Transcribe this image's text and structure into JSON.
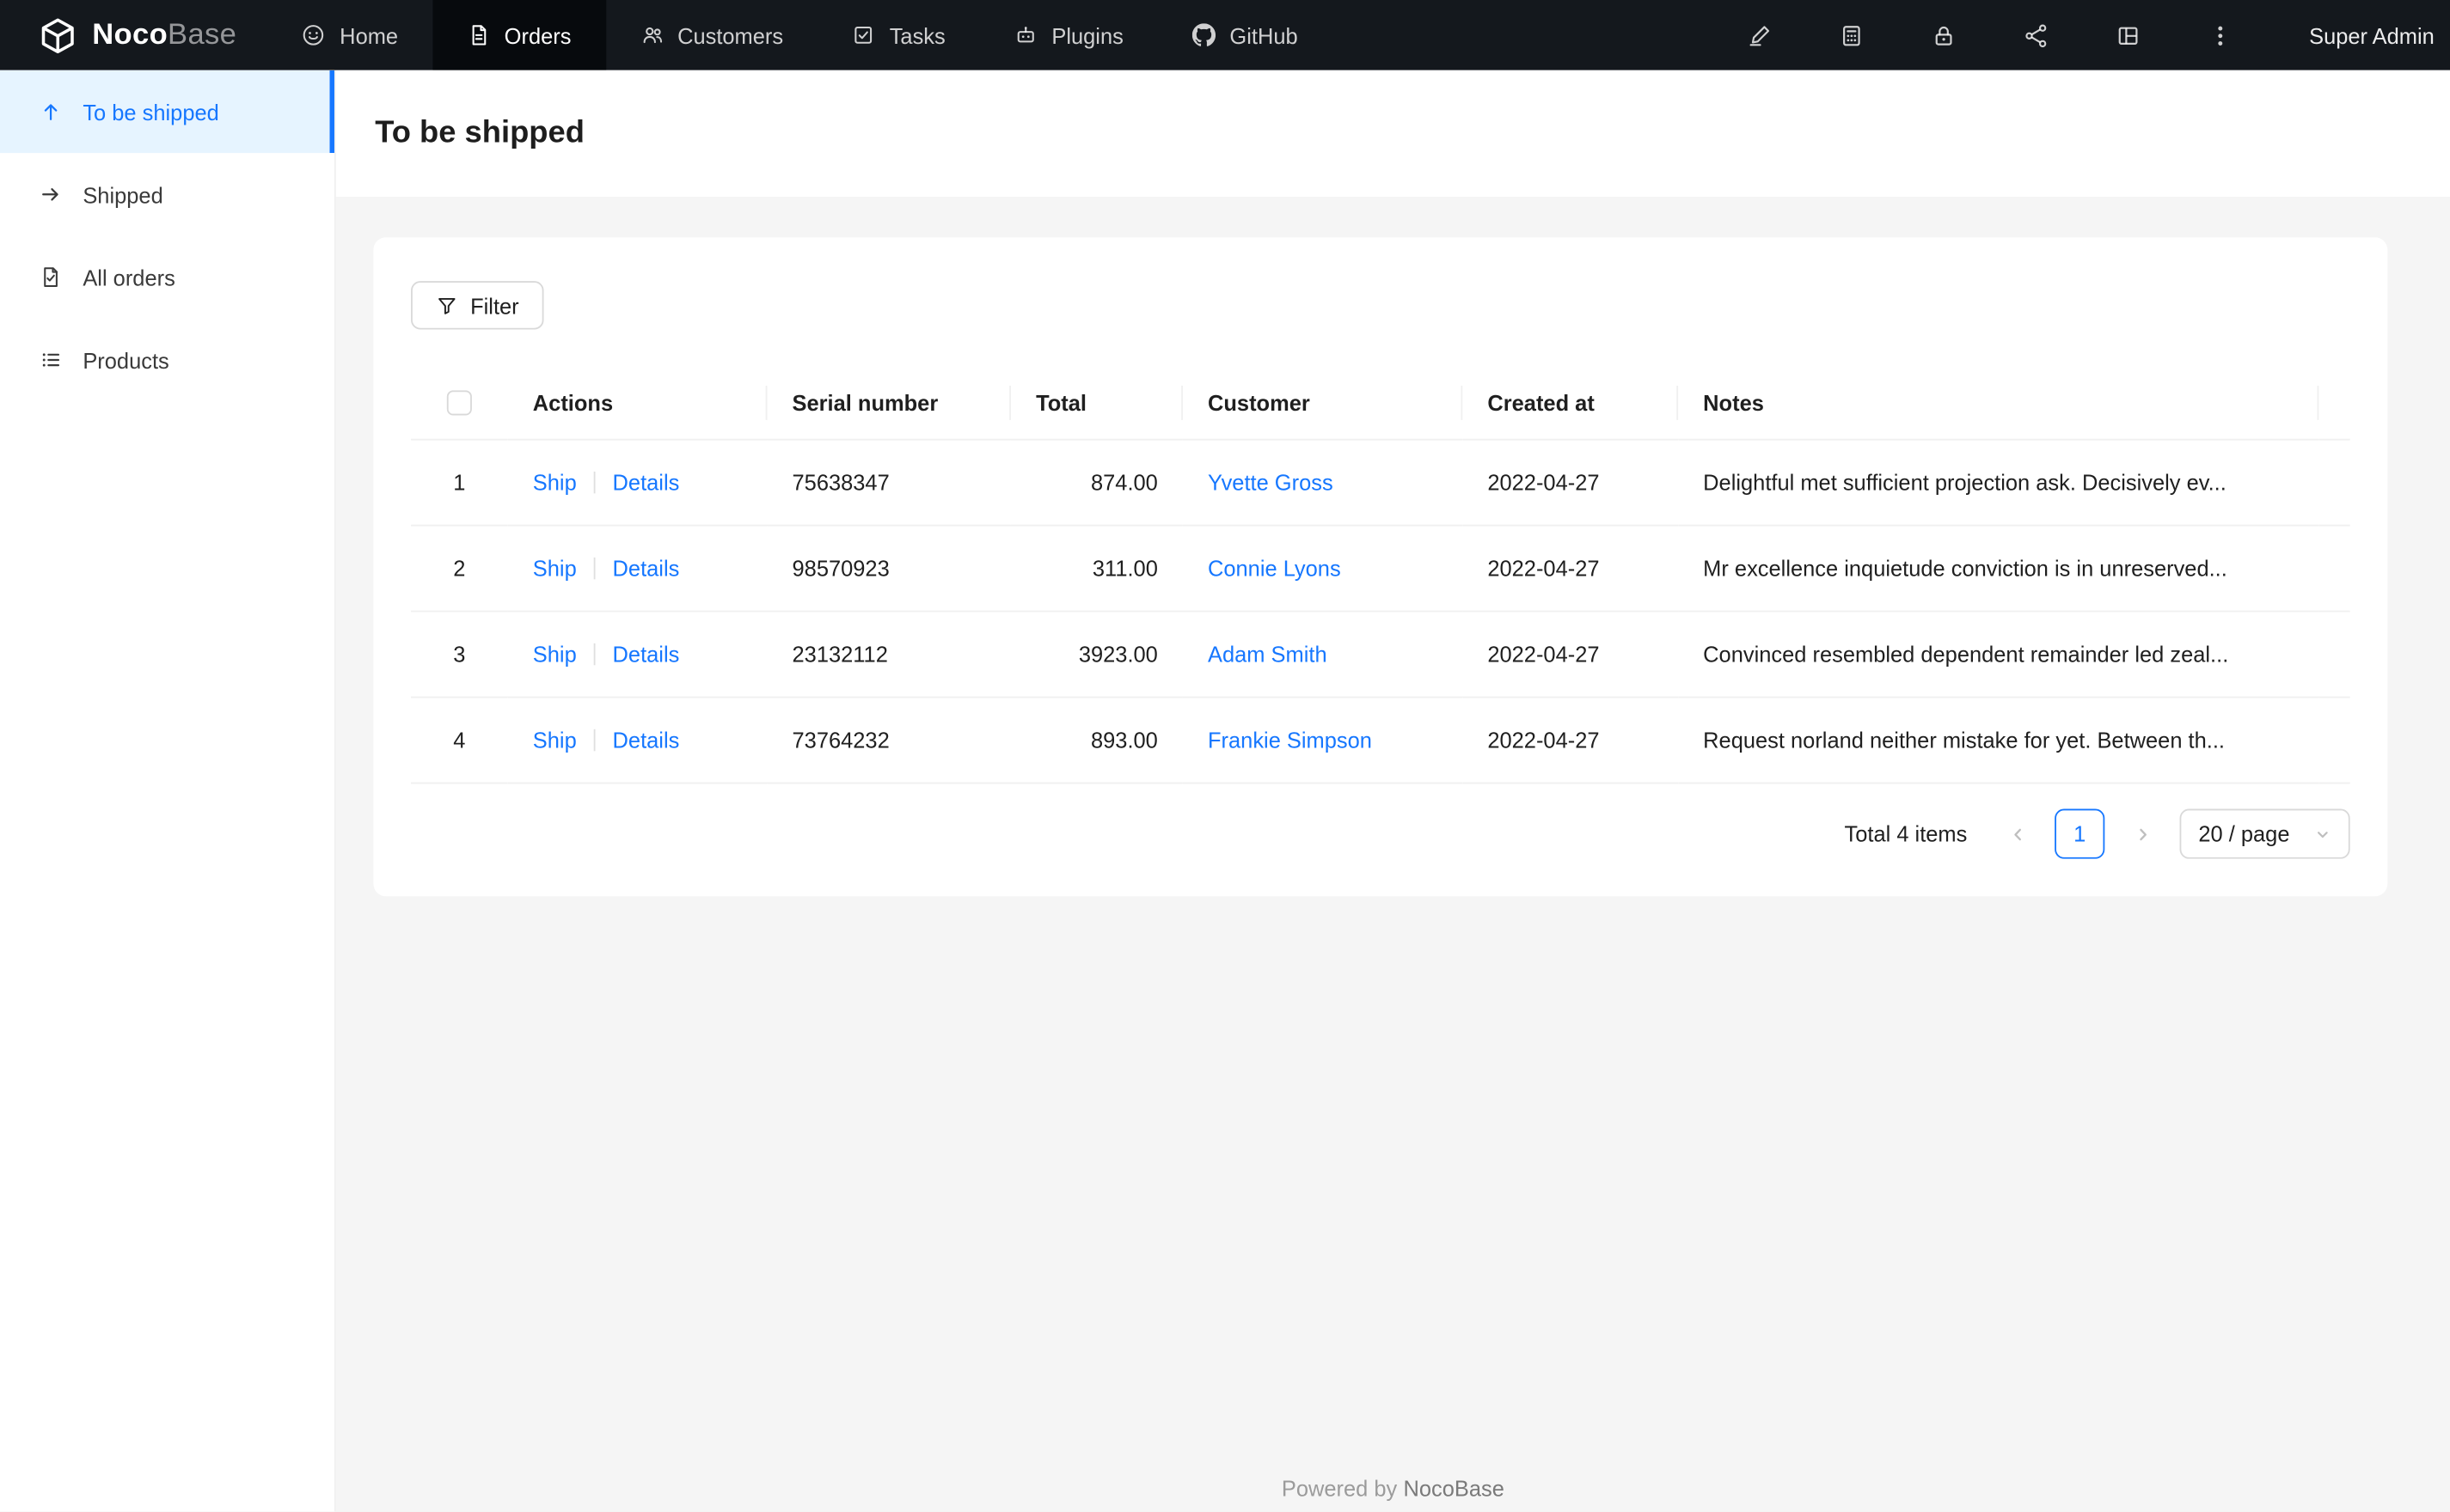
{
  "colors": {
    "accent": "#1677ff",
    "topbar_bg": "#14181d",
    "topbar_active_bg": "#070a0d",
    "sidebar_active_bg": "#e6f4ff"
  },
  "topbar": {
    "logo_bold": "Noco",
    "logo_light": "Base",
    "nav": [
      {
        "label": "Home",
        "icon": "home-icon"
      },
      {
        "label": "Orders",
        "icon": "orders-icon",
        "active": true
      },
      {
        "label": "Customers",
        "icon": "customers-icon"
      },
      {
        "label": "Tasks",
        "icon": "tasks-icon"
      },
      {
        "label": "Plugins",
        "icon": "plugins-icon"
      },
      {
        "label": "GitHub",
        "icon": "github-icon"
      }
    ],
    "right_icons": [
      "highlighter-icon",
      "calculator-icon",
      "lock-icon",
      "share-icon",
      "layout-icon",
      "more-icon"
    ],
    "user": "Super Admin"
  },
  "sidebar": {
    "items": [
      {
        "label": "To be shipped",
        "icon": "arrow-up-icon",
        "active": true
      },
      {
        "label": "Shipped",
        "icon": "arrow-right-icon"
      },
      {
        "label": "All orders",
        "icon": "file-check-icon"
      },
      {
        "label": "Products",
        "icon": "list-icon"
      }
    ]
  },
  "page": {
    "title": "To be shipped"
  },
  "toolbar": {
    "filter": "Filter"
  },
  "table": {
    "headers": {
      "actions": "Actions",
      "serial": "Serial number",
      "total": "Total",
      "customer": "Customer",
      "created": "Created at",
      "notes": "Notes"
    },
    "rows": [
      {
        "index": "1",
        "ship": "Ship",
        "details": "Details",
        "serial": "75638347",
        "total": "874.00",
        "customer": "Yvette Gross",
        "created": "2022-04-27",
        "notes": "Delightful met sufficient projection ask. Decisively ev..."
      },
      {
        "index": "2",
        "ship": "Ship",
        "details": "Details",
        "serial": "98570923",
        "total": "311.00",
        "customer": "Connie Lyons",
        "created": "2022-04-27",
        "notes": "Mr excellence inquietude conviction is in unreserved..."
      },
      {
        "index": "3",
        "ship": "Ship",
        "details": "Details",
        "serial": "23132112",
        "total": "3923.00",
        "customer": "Adam Smith",
        "created": "2022-04-27",
        "notes": "Convinced resembled dependent remainder led zeal..."
      },
      {
        "index": "4",
        "ship": "Ship",
        "details": "Details",
        "serial": "73764232",
        "total": "893.00",
        "customer": "Frankie Simpson",
        "created": "2022-04-27",
        "notes": "Request norland neither mistake for yet. Between th..."
      }
    ]
  },
  "pagination": {
    "total": "Total 4 items",
    "page": "1",
    "page_size": "20 / page"
  },
  "footer": {
    "prefix": "Powered by",
    "brand": "NocoBase"
  }
}
